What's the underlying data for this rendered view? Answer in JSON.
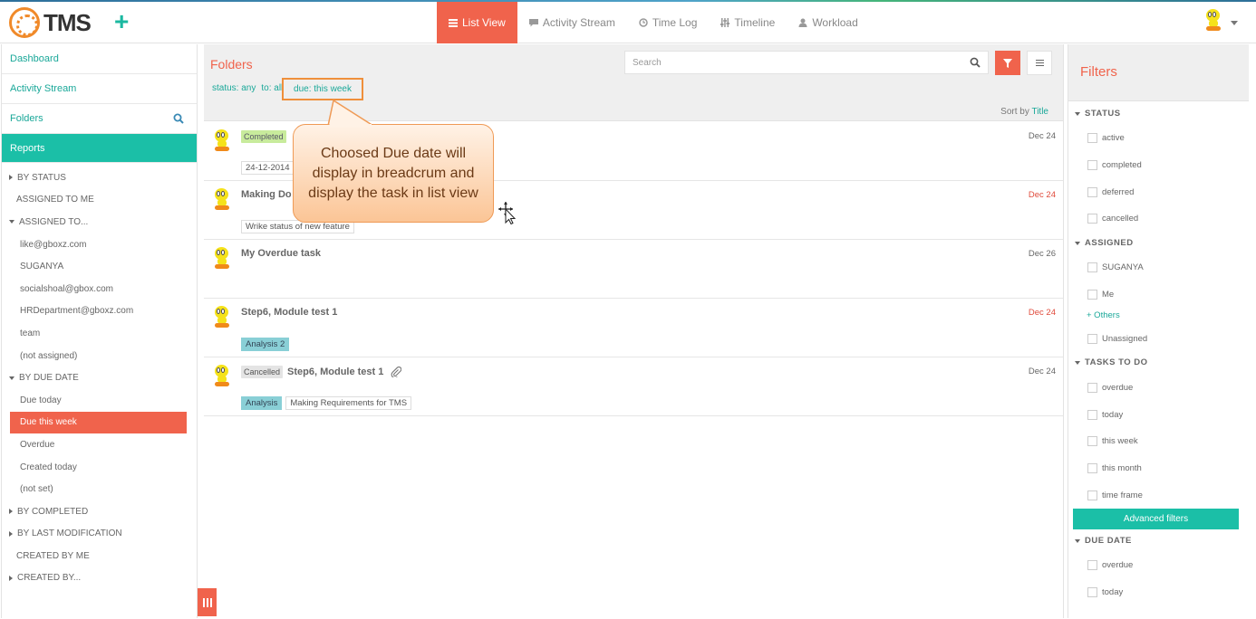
{
  "app": {
    "name": "TMS",
    "add_symbol": "+"
  },
  "nav": {
    "tabs": [
      {
        "label": "List View",
        "icon": "list-icon",
        "active": true
      },
      {
        "label": "Activity Stream",
        "icon": "comment-icon"
      },
      {
        "label": "Time Log",
        "icon": "clock-icon"
      },
      {
        "label": "Timeline",
        "icon": "timeline-icon"
      },
      {
        "label": "Workload",
        "icon": "user-icon"
      }
    ]
  },
  "sidebar": {
    "links": {
      "dashboard": "Dashboard",
      "activity_stream": "Activity Stream",
      "folders": "Folders",
      "reports": "Reports"
    },
    "items": [
      "BY STATUS",
      "ASSIGNED TO ME",
      "ASSIGNED TO...",
      "like@gboxz.com",
      "SUGANYA",
      "socialshoal@gbox.com",
      "HRDepartment@gboxz.com",
      "team",
      "(not assigned)",
      "BY DUE DATE",
      "Due today",
      "Due this week",
      "Overdue",
      "Created today",
      "(not set)",
      "BY COMPLETED",
      "BY LAST MODIFICATION",
      "CREATED BY ME",
      "CREATED BY..."
    ]
  },
  "main": {
    "title": "Folders",
    "search_placeholder": "Search",
    "breadcrumbs": {
      "status": "status: any",
      "to": "to: all",
      "due": "due: this week"
    },
    "sort_label": "Sort by",
    "sort_value": "Title"
  },
  "tasks": [
    {
      "status": "Completed",
      "title": "",
      "date": "Dec 24",
      "tags": [
        "24-12-2014"
      ]
    },
    {
      "status": "",
      "title": "Making Do",
      "date": "Dec 24",
      "overdue": true,
      "tags": [
        "Wrike status of new feature"
      ]
    },
    {
      "status": "",
      "title": "My Overdue task",
      "date": "Dec 26",
      "tags": []
    },
    {
      "status": "",
      "title": "Step6, Module test 1",
      "date": "Dec 24",
      "overdue": true,
      "tags": [
        "Analysis 2"
      ]
    },
    {
      "status": "Cancelled",
      "title": "Step6, Module test 1",
      "date": "Dec 24",
      "tags": [
        "Analysis",
        "Making Requirements for TMS"
      ]
    }
  ],
  "filters": {
    "title": "Filters",
    "status": {
      "label": "STATUS",
      "options": [
        "active",
        "completed",
        "deferred",
        "cancelled"
      ]
    },
    "assigned": {
      "label": "ASSIGNED",
      "options": [
        "SUGANYA",
        "Me"
      ],
      "others_link": "+ Others",
      "unassigned": "Unassigned"
    },
    "tasks_to_do": {
      "label": "TASKS TO DO",
      "options": [
        "overdue",
        "today",
        "this week",
        "this month",
        "time frame"
      ]
    },
    "advanced_button": "Advanced filters",
    "due_date": {
      "label": "DUE DATE",
      "options": [
        "overdue",
        "today"
      ]
    }
  },
  "callout": {
    "text": "Choosed Due date will display in breadcrum and display the task in list view"
  },
  "colors": {
    "accent": "#f0634c",
    "teal": "#1bbfa7",
    "callout_border": "#ef9a55"
  }
}
